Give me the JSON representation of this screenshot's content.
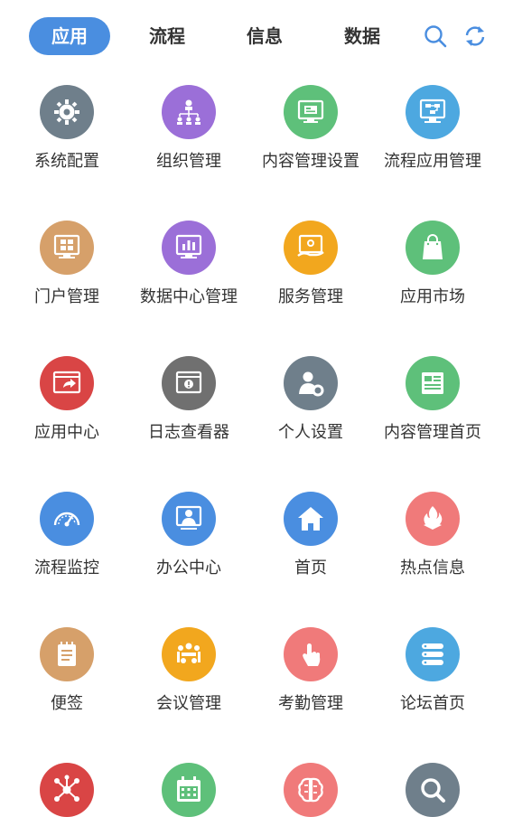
{
  "tabs": [
    {
      "label": "应用",
      "active": true
    },
    {
      "label": "流程",
      "active": false
    },
    {
      "label": "信息",
      "active": false
    },
    {
      "label": "数据",
      "active": false
    }
  ],
  "accent_color": "#4a8ee0",
  "apps": [
    {
      "label": "系统配置",
      "color": "#6f7f8b",
      "icon": "gear-icon"
    },
    {
      "label": "组织管理",
      "color": "#9b6fd8",
      "icon": "org-chart-icon"
    },
    {
      "label": "内容管理设置",
      "color": "#5ec07a",
      "icon": "content-settings-icon"
    },
    {
      "label": "流程应用管理",
      "color": "#4da8e0",
      "icon": "flowchart-icon"
    },
    {
      "label": "门户管理",
      "color": "#d6a06a",
      "icon": "portal-icon"
    },
    {
      "label": "数据中心管理",
      "color": "#9b6fd8",
      "icon": "bar-chart-icon"
    },
    {
      "label": "服务管理",
      "color": "#f2a71e",
      "icon": "service-icon"
    },
    {
      "label": "应用市场",
      "color": "#5ec07a",
      "icon": "shopping-bag-icon"
    },
    {
      "label": "应用中心",
      "color": "#d94545",
      "icon": "app-center-icon"
    },
    {
      "label": "日志查看器",
      "color": "#707070",
      "icon": "log-viewer-icon"
    },
    {
      "label": "个人设置",
      "color": "#6f7f8b",
      "icon": "user-settings-icon"
    },
    {
      "label": "内容管理首页",
      "color": "#5ec07a",
      "icon": "news-icon"
    },
    {
      "label": "流程监控",
      "color": "#4a8ee0",
      "icon": "speedometer-icon"
    },
    {
      "label": "办公中心",
      "color": "#4a8ee0",
      "icon": "office-icon"
    },
    {
      "label": "首页",
      "color": "#4a8ee0",
      "icon": "home-icon"
    },
    {
      "label": "热点信息",
      "color": "#f07a7a",
      "icon": "fire-icon"
    },
    {
      "label": "便签",
      "color": "#d6a06a",
      "icon": "notepad-icon"
    },
    {
      "label": "会议管理",
      "color": "#f2a71e",
      "icon": "meeting-icon"
    },
    {
      "label": "考勤管理",
      "color": "#f07a7a",
      "icon": "touch-icon"
    },
    {
      "label": "论坛首页",
      "color": "#4da8e0",
      "icon": "forum-icon"
    },
    {
      "label": "",
      "color": "#d94545",
      "icon": "network-icon"
    },
    {
      "label": "",
      "color": "#5ec07a",
      "icon": "calendar-icon"
    },
    {
      "label": "",
      "color": "#f07a7a",
      "icon": "brain-icon"
    },
    {
      "label": "",
      "color": "#6f7f8b",
      "icon": "search-icon"
    }
  ]
}
